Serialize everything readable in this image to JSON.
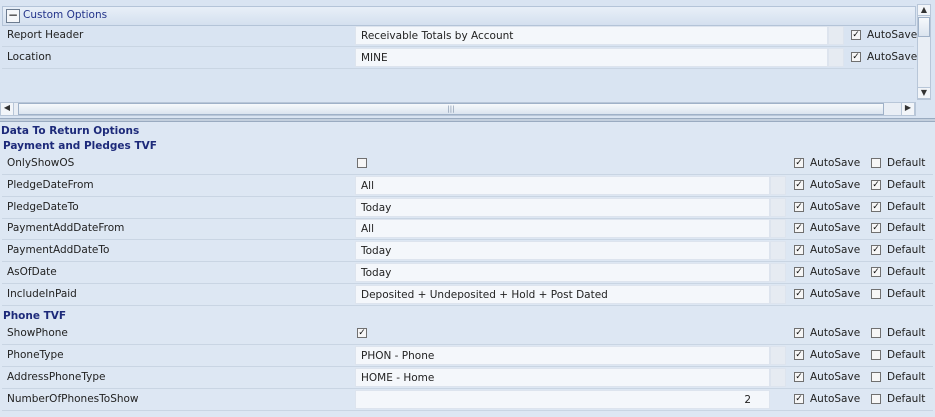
{
  "custom_options": {
    "title": "Custom Options",
    "collapse_glyph": "−",
    "rows": [
      {
        "label": "Report Header",
        "value": "Receivable Totals by Account",
        "autosave_checked": true,
        "autosave_label": "AutoSave"
      },
      {
        "label": "Location",
        "value": "MINE",
        "autosave_checked": true,
        "autosave_label": "AutoSave"
      }
    ],
    "hscroll_grip": "|||"
  },
  "data_return": {
    "title": "Data To Return Options",
    "groups": [
      {
        "title": "Payment and Pledges TVF",
        "rows": [
          {
            "label": "OnlyShowOS",
            "type": "checkbox",
            "checked": false,
            "autosave": true,
            "default": false
          },
          {
            "label": "PledgeDateFrom",
            "type": "text",
            "value": "All",
            "autosave": true,
            "default": true
          },
          {
            "label": "PledgeDateTo",
            "type": "text",
            "value": "Today",
            "autosave": true,
            "default": true
          },
          {
            "label": "PaymentAddDateFrom",
            "type": "text",
            "value": "All",
            "autosave": true,
            "default": true
          },
          {
            "label": "PaymentAddDateTo",
            "type": "text",
            "value": "Today",
            "autosave": true,
            "default": true
          },
          {
            "label": "AsOfDate",
            "type": "text",
            "value": "Today",
            "autosave": true,
            "default": true
          },
          {
            "label": "IncludeInPaid",
            "type": "text",
            "value": "Deposited + Undeposited + Hold + Post Dated",
            "autosave": true,
            "default": false
          }
        ]
      },
      {
        "title": "Phone TVF",
        "rows": [
          {
            "label": "ShowPhone",
            "type": "checkbox",
            "checked": true,
            "autosave": true,
            "default": false
          },
          {
            "label": "PhoneType",
            "type": "text",
            "value": "PHON - Phone",
            "autosave": true,
            "default": false
          },
          {
            "label": "AddressPhoneType",
            "type": "text",
            "value": "HOME - Home",
            "autosave": true,
            "default": false
          },
          {
            "label": "NumberOfPhonesToShow",
            "type": "number",
            "value": "2",
            "autosave": true,
            "default": false
          }
        ]
      }
    ],
    "autosave_label": "AutoSave",
    "default_label": "Default"
  },
  "glyphs": {
    "check": "✓",
    "up": "▲",
    "down": "▼",
    "left": "◀",
    "right": "▶"
  }
}
